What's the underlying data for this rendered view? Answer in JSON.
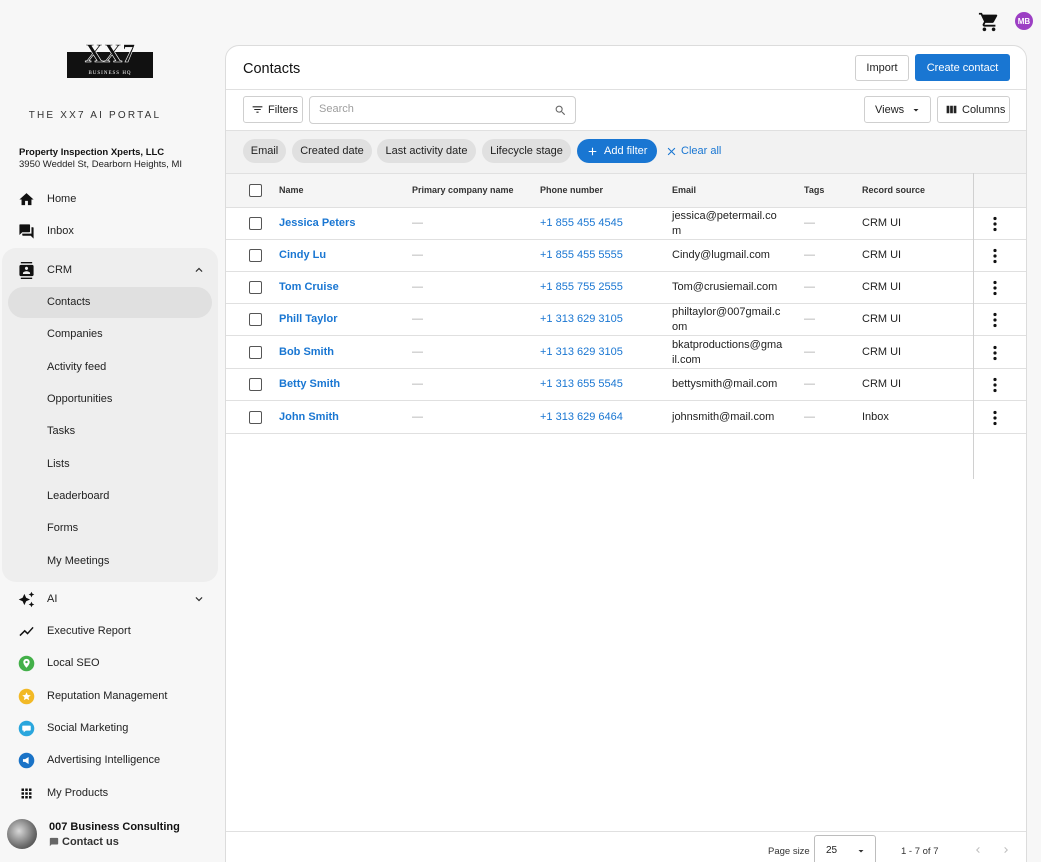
{
  "topbar": {
    "avatar_initials": "MB"
  },
  "sidebar": {
    "logo_text": "XX7",
    "logo_subtext": "BUSINESS HQ",
    "portal_title": "THE XX7 AI PORTAL",
    "business_name": "Property Inspection Xperts, LLC",
    "business_address": "3950 Weddel St, Dearborn Heights, MI",
    "items": [
      {
        "label": "Home",
        "icon": "home-icon"
      },
      {
        "label": "Inbox",
        "icon": "inbox-icon"
      },
      {
        "label": "CRM",
        "icon": "contacts-book-icon",
        "expanded": true
      },
      {
        "label": "AI",
        "icon": "sparkle-icon",
        "expanded": false
      },
      {
        "label": "Executive Report",
        "icon": "trend-icon"
      },
      {
        "label": "Local SEO",
        "icon": "location-icon"
      },
      {
        "label": "Reputation Management",
        "icon": "star-icon"
      },
      {
        "label": "Social Marketing",
        "icon": "chat-icon"
      },
      {
        "label": "Advertising Intelligence",
        "icon": "megaphone-icon"
      },
      {
        "label": "My Products",
        "icon": "grid-icon"
      }
    ],
    "crm_sub": [
      "Contacts",
      "Companies",
      "Activity feed",
      "Opportunities",
      "Tasks",
      "Lists",
      "Leaderboard",
      "Forms",
      "My Meetings"
    ],
    "active_sub": "Contacts",
    "footer_name": "007 Business Consulting",
    "footer_contact": "Contact us"
  },
  "panel": {
    "title": "Contacts",
    "import_label": "Import",
    "create_label": "Create contact",
    "filters_label": "Filters",
    "search_placeholder": "Search",
    "views_label": "Views",
    "columns_label": "Columns",
    "chips": [
      "Email",
      "Created date",
      "Last activity date",
      "Lifecycle stage"
    ],
    "add_filter_label": "Add filter",
    "clear_all_label": "Clear all"
  },
  "table": {
    "headers": [
      "Name",
      "Primary company name",
      "Phone number",
      "Email",
      "Tags",
      "Record source"
    ],
    "rows": [
      {
        "name": "Jessica Peters",
        "company": "—",
        "phone": "+1 855 455 4545",
        "email": [
          "jessica@petermail.co",
          "m"
        ],
        "tags": "—",
        "source": "CRM UI"
      },
      {
        "name": "Cindy Lu",
        "company": "—",
        "phone": "+1 855 455 5555",
        "email": [
          "Cindy@lugmail.com"
        ],
        "tags": "—",
        "source": "CRM UI"
      },
      {
        "name": "Tom Cruise",
        "company": "—",
        "phone": "+1 855 755 2555",
        "email": [
          "Tom@crusiemail.com"
        ],
        "tags": "—",
        "source": "CRM UI"
      },
      {
        "name": "Phill Taylor",
        "company": "—",
        "phone": "+1 313 629 3105",
        "email": [
          "philtaylor@007gmail.c",
          "om"
        ],
        "tags": "—",
        "source": "CRM UI"
      },
      {
        "name": "Bob Smith",
        "company": "—",
        "phone": "+1 313 629 3105",
        "email": [
          "bkatproductions@gma",
          "il.com"
        ],
        "tags": "—",
        "source": "CRM UI"
      },
      {
        "name": "Betty Smith",
        "company": "—",
        "phone": "+1 313 655 5545",
        "email": [
          "bettysmith@mail.com"
        ],
        "tags": "—",
        "source": "CRM UI"
      },
      {
        "name": "John Smith",
        "company": "—",
        "phone": "+1 313 629 6464",
        "email": [
          "johnsmith@mail.com"
        ],
        "tags": "—",
        "source": "Inbox"
      }
    ]
  },
  "pager": {
    "page_size_label": "Page size",
    "page_size_value": "25",
    "range_label": "1 - 7 of 7"
  },
  "colors": {
    "accent": "#1976d2",
    "avatar": "#9c3fc4"
  }
}
